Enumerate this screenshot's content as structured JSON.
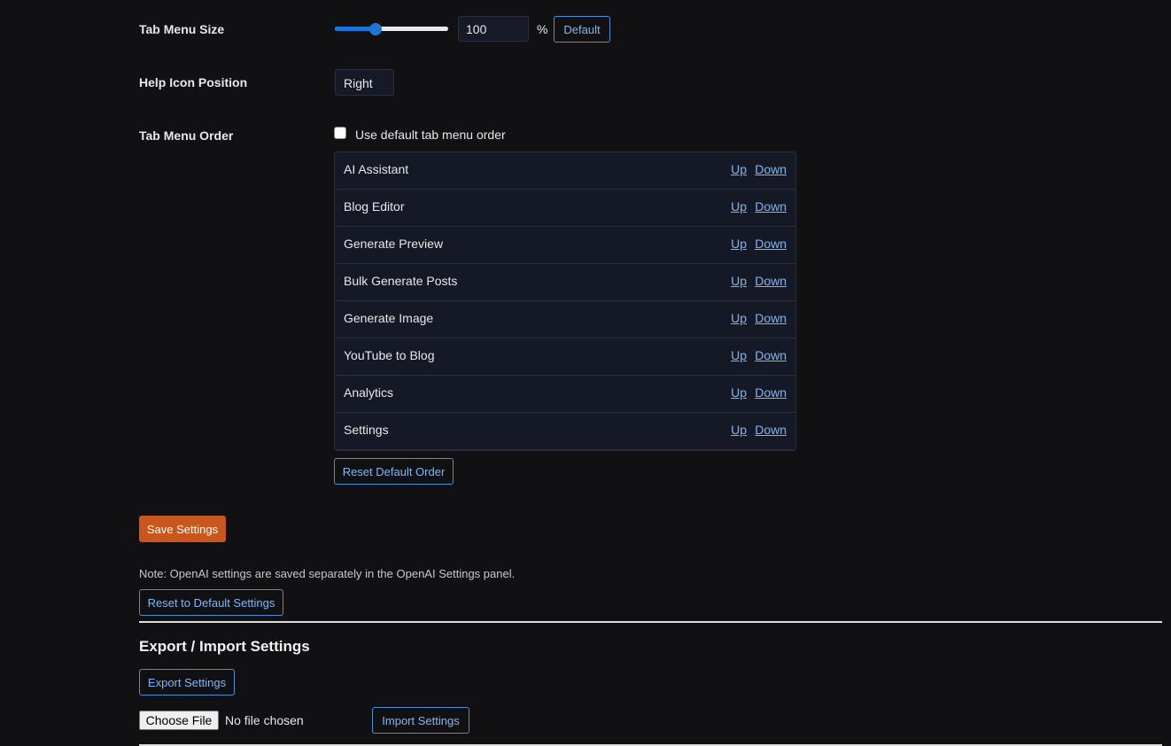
{
  "tab_menu_size": {
    "label": "Tab Menu Size",
    "slider_percent": 36,
    "value": "100",
    "unit": "%",
    "default_button": "Default"
  },
  "help_icon_position": {
    "label": "Help Icon Position",
    "selected": "Right"
  },
  "tab_menu_order": {
    "label": "Tab Menu Order",
    "checkbox_label": "Use default tab menu order",
    "checked": false,
    "items": [
      {
        "name": "AI Assistant",
        "up": "Up",
        "down": "Down"
      },
      {
        "name": "Blog Editor",
        "up": "Up",
        "down": "Down"
      },
      {
        "name": "Generate Preview",
        "up": "Up",
        "down": "Down"
      },
      {
        "name": "Bulk Generate Posts",
        "up": "Up",
        "down": "Down"
      },
      {
        "name": "Generate Image",
        "up": "Up",
        "down": "Down"
      },
      {
        "name": "YouTube to Blog",
        "up": "Up",
        "down": "Down"
      },
      {
        "name": "Analytics",
        "up": "Up",
        "down": "Down"
      },
      {
        "name": "Settings",
        "up": "Up",
        "down": "Down"
      }
    ],
    "reset_order_button": "Reset Default Order"
  },
  "save_button": "Save Settings",
  "note": "Note: OpenAI settings are saved separately in the OpenAI Settings panel.",
  "reset_defaults_button": "Reset to Default Settings",
  "export_import": {
    "title": "Export / Import Settings",
    "export_button": "Export Settings",
    "choose_file_button": "Choose File",
    "file_status": "No file chosen",
    "import_button": "Import Settings"
  },
  "colors": {
    "background": "#111114",
    "accent": "#1f75d6",
    "save": "#c8561d",
    "link": "#7fb6f2"
  }
}
